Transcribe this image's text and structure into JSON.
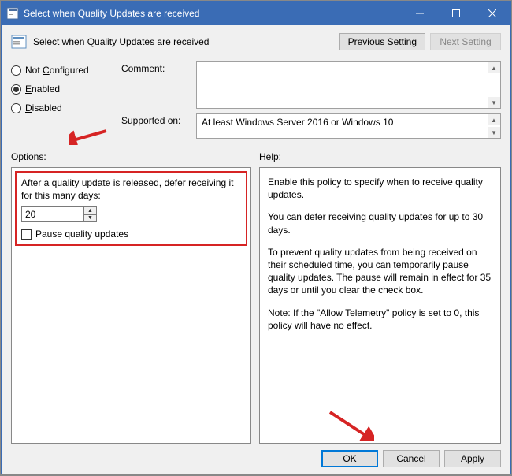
{
  "window": {
    "title": "Select when Quality Updates are received"
  },
  "header": {
    "title": "Select when Quality Updates are received",
    "prev_btn": "Previous Setting",
    "next_btn": "Next Setting"
  },
  "radios": {
    "not_configured": "Not Configured",
    "enabled": "Enabled",
    "disabled": "Disabled",
    "selected": "enabled"
  },
  "form": {
    "comment_label": "Comment:",
    "comment_value": "",
    "supported_label": "Supported on:",
    "supported_value": "At least Windows Server 2016 or Windows 10"
  },
  "panels": {
    "options_label": "Options:",
    "help_label": "Help:"
  },
  "options": {
    "defer_text": "After a quality update is released, defer receiving it for this many days:",
    "defer_value": "20",
    "pause_label": "Pause quality updates",
    "pause_checked": false
  },
  "help": {
    "p1": "Enable this policy to specify when to receive quality updates.",
    "p2": "You can defer receiving quality updates for up to 30 days.",
    "p3": "To prevent quality updates from being received on their scheduled time, you can temporarily pause quality updates. The pause will remain in effect for 35 days or until you clear the check box.",
    "p4": "Note: If the \"Allow Telemetry\" policy is set to 0, this policy will have no effect."
  },
  "buttons": {
    "ok": "OK",
    "cancel": "Cancel",
    "apply": "Apply"
  }
}
